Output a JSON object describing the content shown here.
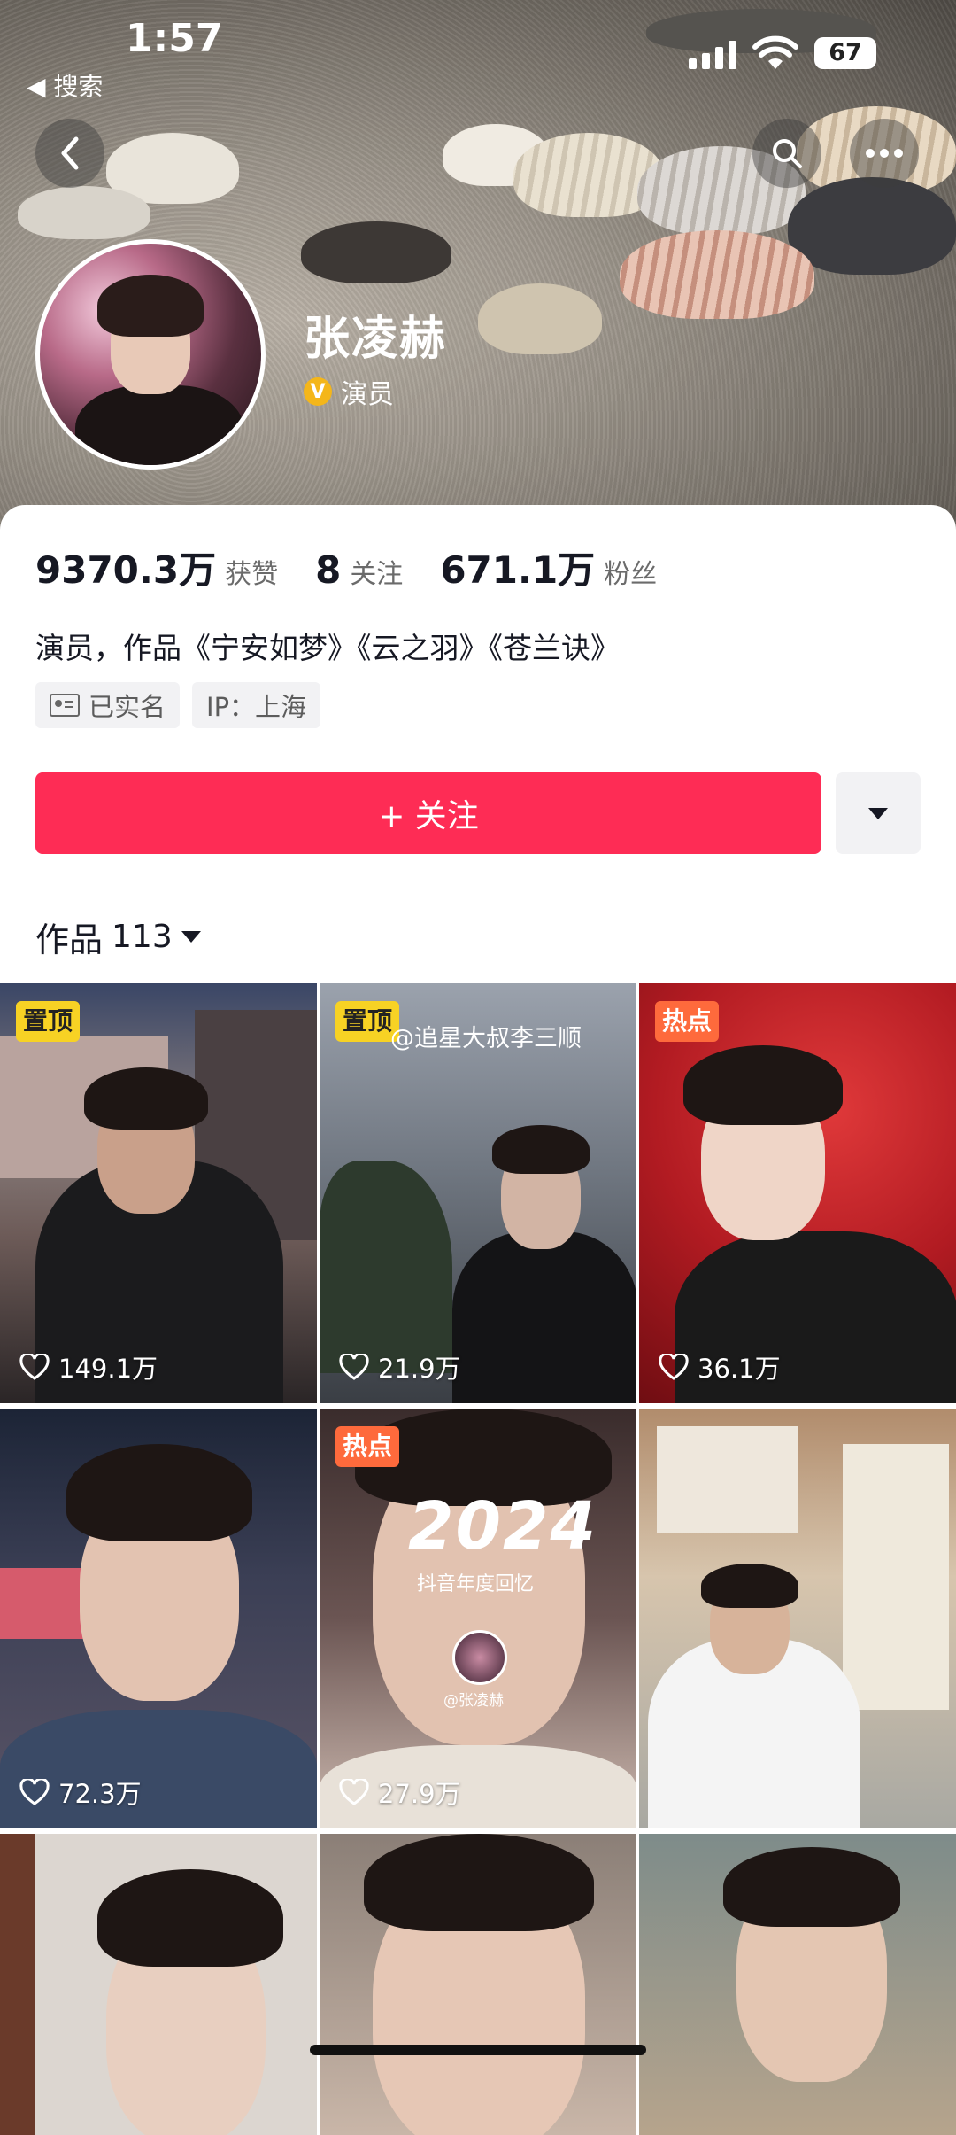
{
  "status_bar": {
    "time": "1:57",
    "back_app": "◀ 搜索",
    "battery": "67"
  },
  "profile": {
    "name": "张凌赫",
    "verify_label": "演员",
    "verify_badge": "V",
    "stats": [
      {
        "value": "9370.3万",
        "label": "获赞"
      },
      {
        "value": "8",
        "label": "关注"
      },
      {
        "value": "671.1万",
        "label": "粉丝"
      }
    ],
    "bio": "演员，作品《宁安如梦》《云之羽》《苍兰诀》",
    "tags": [
      "已实名",
      "IP：上海"
    ],
    "follow_button": "+ 关注"
  },
  "works": {
    "label": "作品",
    "count": "113"
  },
  "videos": [
    {
      "badge": "置顶",
      "badge_type": "pin",
      "likes": "149.1万",
      "watermark": ""
    },
    {
      "badge": "置顶",
      "badge_type": "pin",
      "likes": "21.9万",
      "watermark": "@追星大叔李三顺"
    },
    {
      "badge": "热点",
      "badge_type": "hot",
      "likes": "36.1万",
      "watermark": ""
    },
    {
      "badge": "",
      "badge_type": "",
      "likes": "72.3万",
      "watermark": ""
    },
    {
      "badge": "热点",
      "badge_type": "hot",
      "likes": "27.9万",
      "watermark": "",
      "overlay_title": "2024",
      "overlay_sub": "抖音年度回忆",
      "overlay_handle": "@张凌赫"
    },
    {
      "badge": "",
      "badge_type": "",
      "likes": "",
      "watermark": ""
    },
    {
      "badge": "",
      "badge_type": "",
      "likes": "",
      "watermark": ""
    },
    {
      "badge": "",
      "badge_type": "",
      "likes": "",
      "watermark": ""
    },
    {
      "badge": "",
      "badge_type": "",
      "likes": "",
      "watermark": ""
    }
  ],
  "colors": {
    "primary": "#fe2c55",
    "pin_badge": "#f7d224",
    "hot_badge": "#fe6a3c",
    "verify": "#f4b61a"
  }
}
